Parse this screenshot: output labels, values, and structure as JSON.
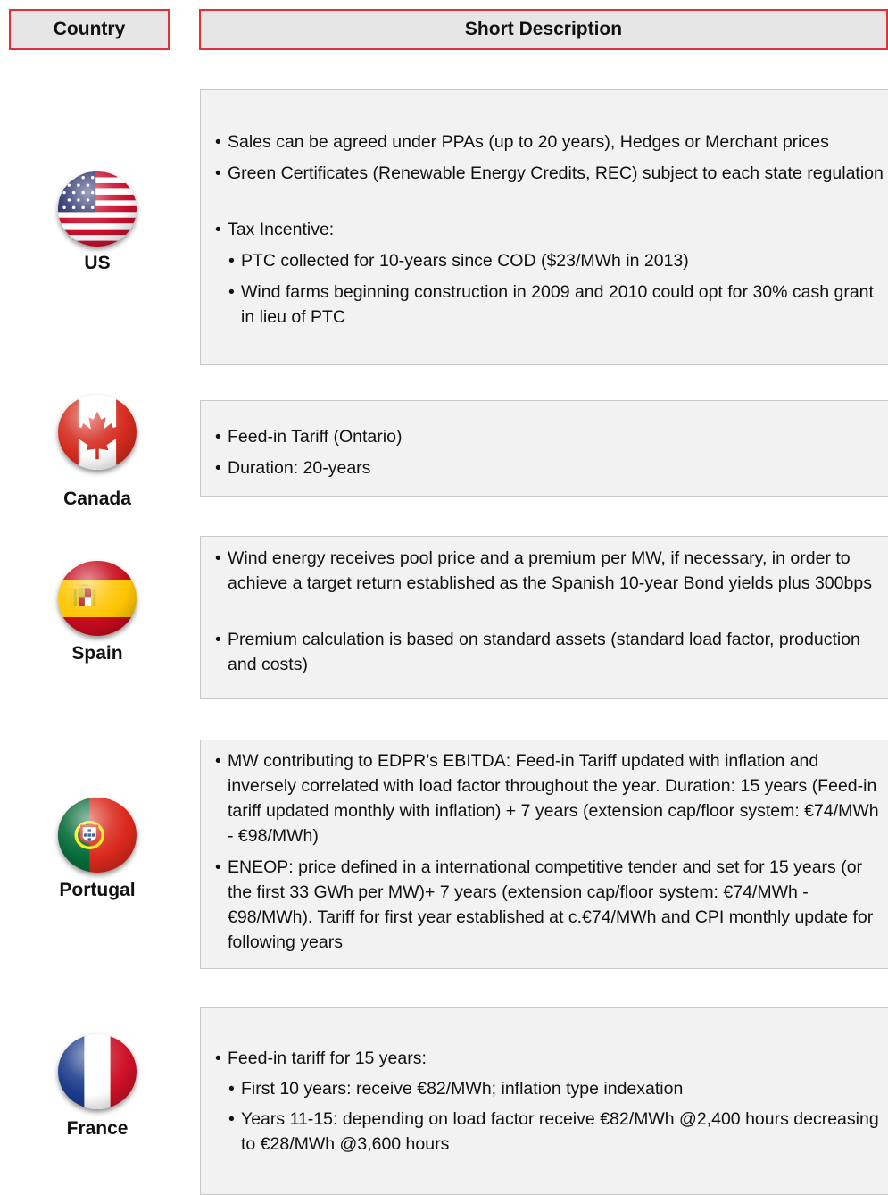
{
  "header": {
    "country_label": "Country",
    "description_label": "Short Description"
  },
  "countries": [
    {
      "name": "US",
      "flag_icon": "us-flag-icon",
      "bullets": [
        {
          "level": 1,
          "text": "Sales can be agreed under PPAs (up to 20 years), Hedges or Merchant prices"
        },
        {
          "level": 1,
          "text": "Green Certificates (Renewable Energy Credits, REC) subject to each state regulation"
        },
        {
          "level": 1,
          "text": "Tax Incentive:"
        },
        {
          "level": 2,
          "text": "PTC collected for 10-years since COD ($23/MWh in 2013)"
        },
        {
          "level": 2,
          "text": "Wind farms beginning construction in 2009 and 2010 could opt for 30% cash grant in lieu of PTC"
        }
      ]
    },
    {
      "name": "Canada",
      "flag_icon": "canada-flag-icon",
      "bullets": [
        {
          "level": 1,
          "text": "Feed-in Tariff (Ontario)"
        },
        {
          "level": 1,
          "text": "Duration: 20-years"
        }
      ]
    },
    {
      "name": "Spain",
      "flag_icon": "spain-flag-icon",
      "bullets": [
        {
          "level": 1,
          "text": "Wind energy receives pool price and a premium per MW, if necessary, in order to achieve a target return established as the Spanish 10-year Bond yields plus 300bps"
        },
        {
          "level": 1,
          "text": "Premium calculation is based on standard assets (standard load factor, production and costs)"
        }
      ]
    },
    {
      "name": "Portugal",
      "flag_icon": "portugal-flag-icon",
      "bullets": [
        {
          "level": 1,
          "text": "MW contributing to EDPR’s EBITDA: Feed-in Tariff updated with inflation and inversely correlated with load factor throughout the year. Duration: 15 years (Feed-in tariff updated monthly with inflation) + 7 years (extension cap/floor system: €74/MWh - €98/MWh)"
        },
        {
          "level": 1,
          "text": "ENEOP: price defined in a international competitive tender and set for 15 years (or the first 33 GWh per MW)+ 7 years (extension cap/floor system: €74/MWh - €98/MWh). Tariff for first year established at c.€74/MWh and CPI monthly update for following years"
        }
      ]
    },
    {
      "name": "France",
      "flag_icon": "france-flag-icon",
      "bullets": [
        {
          "level": 1,
          "text": "Feed-in tariff for 15 years:"
        },
        {
          "level": 2,
          "text": "First 10 years: receive €82/MWh; inflation type indexation"
        },
        {
          "level": 2,
          "text": "Years 11-15: depending on load factor receive €82/MWh @2,400 hours decreasing to €28/MWh @3,600 hours"
        }
      ]
    }
  ]
}
